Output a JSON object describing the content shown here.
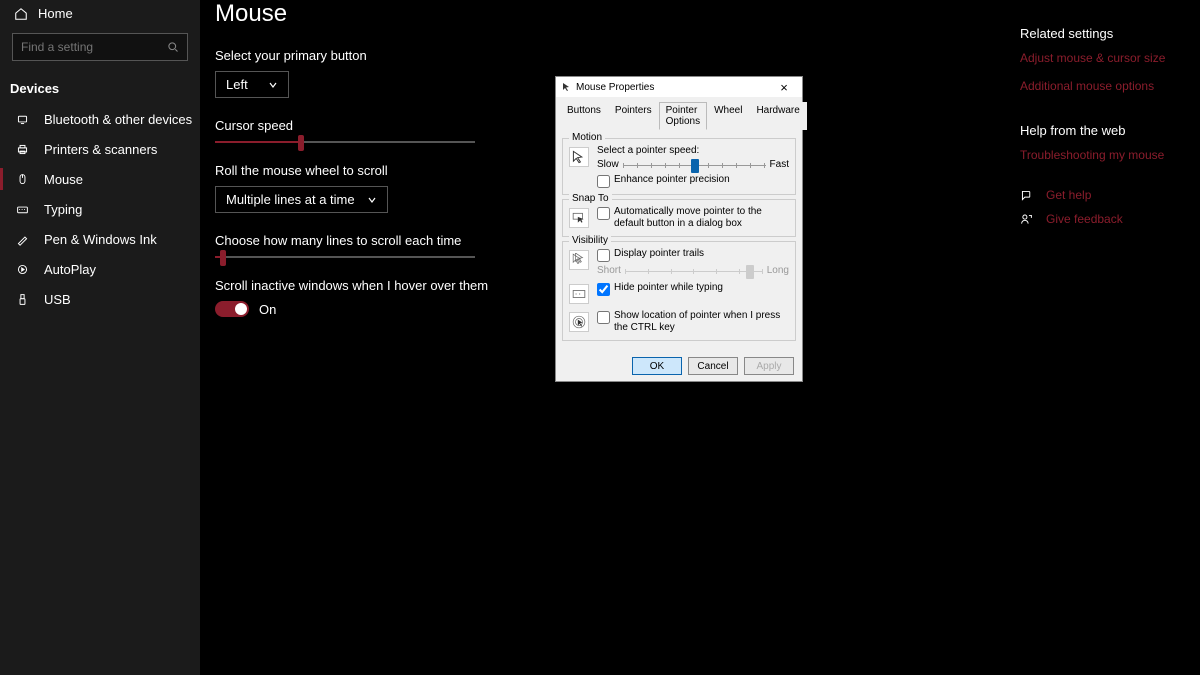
{
  "sidebar": {
    "home_label": "Home",
    "search_placeholder": "Find a setting",
    "category_header": "Devices",
    "items": [
      {
        "label": "Bluetooth & other devices"
      },
      {
        "label": "Printers & scanners"
      },
      {
        "label": "Mouse"
      },
      {
        "label": "Typing"
      },
      {
        "label": "Pen & Windows Ink"
      },
      {
        "label": "AutoPlay"
      },
      {
        "label": "USB"
      }
    ],
    "active_index": 2
  },
  "main": {
    "title": "Mouse",
    "primary_button_label": "Select your primary button",
    "primary_button_value": "Left",
    "cursor_speed_label": "Cursor speed",
    "cursor_speed_pct": 32,
    "roll_wheel_label": "Roll the mouse wheel to scroll",
    "roll_wheel_value": "Multiple lines at a time",
    "lines_label": "Choose how many lines to scroll each time",
    "lines_pct": 2,
    "inactive_label": "Scroll inactive windows when I hover over them",
    "inactive_value": "On"
  },
  "right": {
    "related_header": "Related settings",
    "link_adjust": "Adjust mouse & cursor size",
    "link_additional": "Additional mouse options",
    "help_header": "Help from the web",
    "link_troubleshoot": "Troubleshooting my mouse",
    "get_help": "Get help",
    "give_feedback": "Give feedback"
  },
  "dialog": {
    "title": "Mouse Properties",
    "tabs": {
      "buttons": "Buttons",
      "pointers": "Pointers",
      "pointer_options": "Pointer Options",
      "wheel": "Wheel",
      "hardware": "Hardware"
    },
    "motion": {
      "group": "Motion",
      "select_speed": "Select a pointer speed:",
      "slow": "Slow",
      "fast": "Fast",
      "speed_pct": 50,
      "enhance": "Enhance pointer precision",
      "enhance_checked": false
    },
    "snap": {
      "group": "Snap To",
      "auto_move": "Automatically move pointer to the default button in a dialog box",
      "auto_checked": false
    },
    "visibility": {
      "group": "Visibility",
      "trails": "Display pointer trails",
      "trails_checked": false,
      "short": "Short",
      "long": "Long",
      "trail_pct": 90,
      "hide": "Hide pointer while typing",
      "hide_checked": true,
      "ctrl": "Show location of pointer when I press the CTRL key",
      "ctrl_checked": false
    },
    "buttons_row": {
      "ok": "OK",
      "cancel": "Cancel",
      "apply": "Apply"
    }
  }
}
